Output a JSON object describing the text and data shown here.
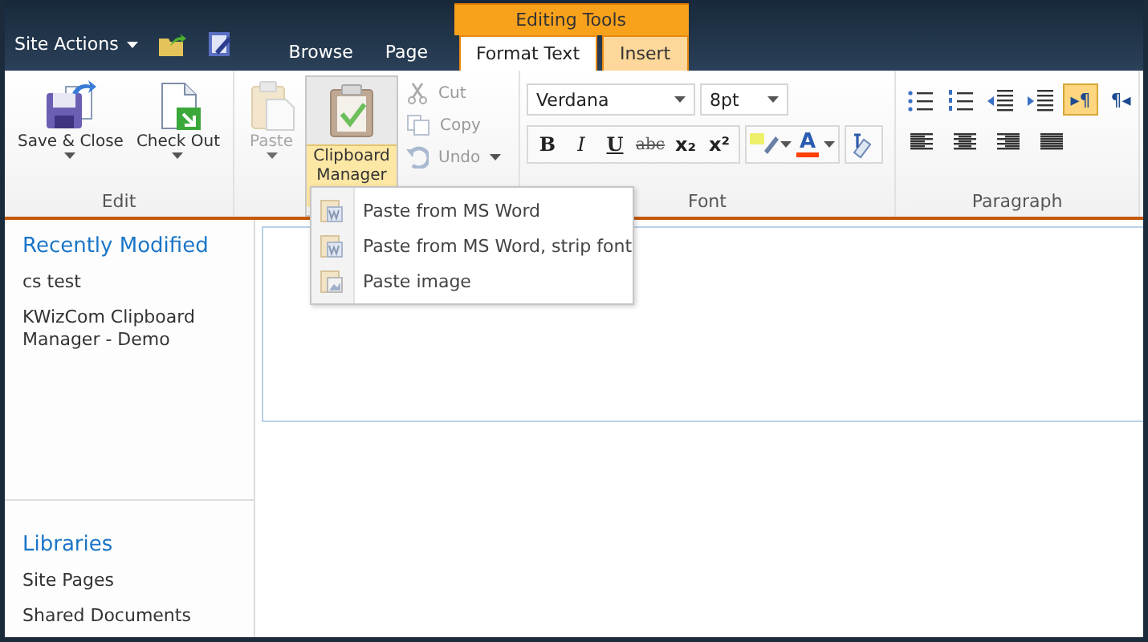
{
  "top_bar": {
    "site_actions": "Site Actions",
    "context_group": "Editing Tools",
    "tabs": [
      {
        "label": "Browse",
        "selected": false,
        "contextual": false
      },
      {
        "label": "Page",
        "selected": false,
        "contextual": false
      },
      {
        "label": "Format Text",
        "selected": true,
        "contextual": true
      },
      {
        "label": "Insert",
        "selected": false,
        "contextual": true
      }
    ]
  },
  "ribbon": {
    "edit": {
      "label": "Edit",
      "buttons": [
        {
          "kind": "save",
          "label": "Save & Close"
        },
        {
          "kind": "checkout",
          "label": "Check Out"
        }
      ]
    },
    "clipboard": {
      "paste": {
        "label": "Paste",
        "disabled": true
      },
      "manager": {
        "label": "Clipboard Manager",
        "selected": true
      },
      "small": [
        {
          "kind": "cut",
          "label": "Cut",
          "disabled": true
        },
        {
          "kind": "copy",
          "label": "Copy",
          "disabled": true
        },
        {
          "kind": "undo",
          "label": "Undo",
          "disabled": true
        }
      ]
    },
    "font": {
      "label": "Font",
      "font_name": "Verdana",
      "font_size": "8pt",
      "styles": [
        {
          "kind": "bold",
          "label": "B"
        },
        {
          "kind": "italic",
          "label": "I"
        },
        {
          "kind": "underline",
          "label": "U"
        },
        {
          "kind": "strike",
          "label": "abc"
        },
        {
          "kind": "sub",
          "label": "x₂"
        },
        {
          "kind": "sup",
          "label": "x²"
        }
      ],
      "font_color": {
        "label": "A",
        "color": "#ff4000"
      }
    },
    "paragraph": {
      "label": "Paragraph",
      "buttons": [
        {
          "kind": "bullets",
          "selected": false
        },
        {
          "kind": "numbering",
          "selected": false
        },
        {
          "kind": "outdent",
          "selected": false
        },
        {
          "kind": "indent",
          "selected": false
        },
        {
          "kind": "ltr",
          "label": "▸¶",
          "selected": true
        },
        {
          "kind": "rtl",
          "label": "¶◂",
          "selected": false
        }
      ],
      "align": [
        {
          "kind": "left"
        },
        {
          "kind": "center"
        },
        {
          "kind": "right"
        },
        {
          "kind": "justify"
        }
      ]
    }
  },
  "menu": {
    "items": [
      {
        "kind": "word",
        "label": "Paste from MS Word"
      },
      {
        "kind": "word",
        "label": "Paste from MS Word, strip font"
      },
      {
        "kind": "image",
        "label": "Paste image"
      }
    ]
  },
  "sidebar": {
    "sections": [
      {
        "heading": "Recently Modified",
        "items": [
          "cs test",
          "KWizCom Clipboard Manager - Demo"
        ]
      },
      {
        "heading": "Libraries",
        "items": [
          "Site Pages",
          "Shared Documents"
        ]
      }
    ]
  }
}
